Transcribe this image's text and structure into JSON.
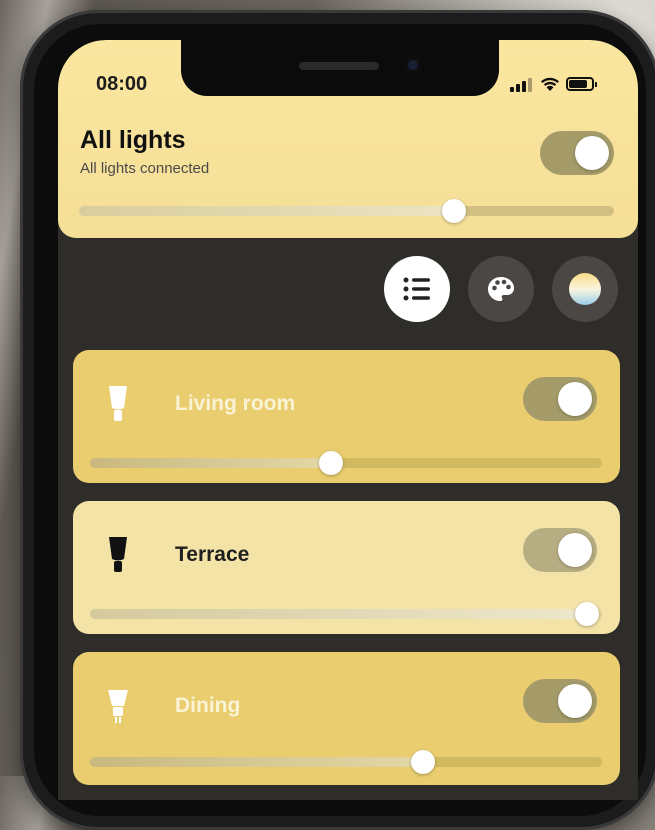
{
  "status_bar": {
    "time": "08:00",
    "icons": [
      "signal-icon",
      "wifi-icon",
      "battery-icon"
    ]
  },
  "all_lights": {
    "title": "All lights",
    "subtitle": "All lights connected",
    "on": true,
    "brightness": 0.7
  },
  "view_buttons": [
    {
      "name": "list-view-icon",
      "active": true
    },
    {
      "name": "palette-icon",
      "active": false
    },
    {
      "name": "scene-gradient-icon",
      "active": false
    }
  ],
  "rooms": [
    {
      "name": "Living room",
      "icon": "ceiling-bulb-icon",
      "on": true,
      "brightness": 0.47
    },
    {
      "name": "Terrace",
      "icon": "ceiling-bulb-icon",
      "on": true,
      "brightness": 0.97
    },
    {
      "name": "Dining",
      "icon": "spot-bulb-icon",
      "on": true,
      "brightness": 0.65
    }
  ],
  "colors": {
    "accent_bright": "#e9cd6f",
    "accent_pale": "#f4e3a7",
    "header": "#f5df97",
    "background": "#2f2d29"
  }
}
